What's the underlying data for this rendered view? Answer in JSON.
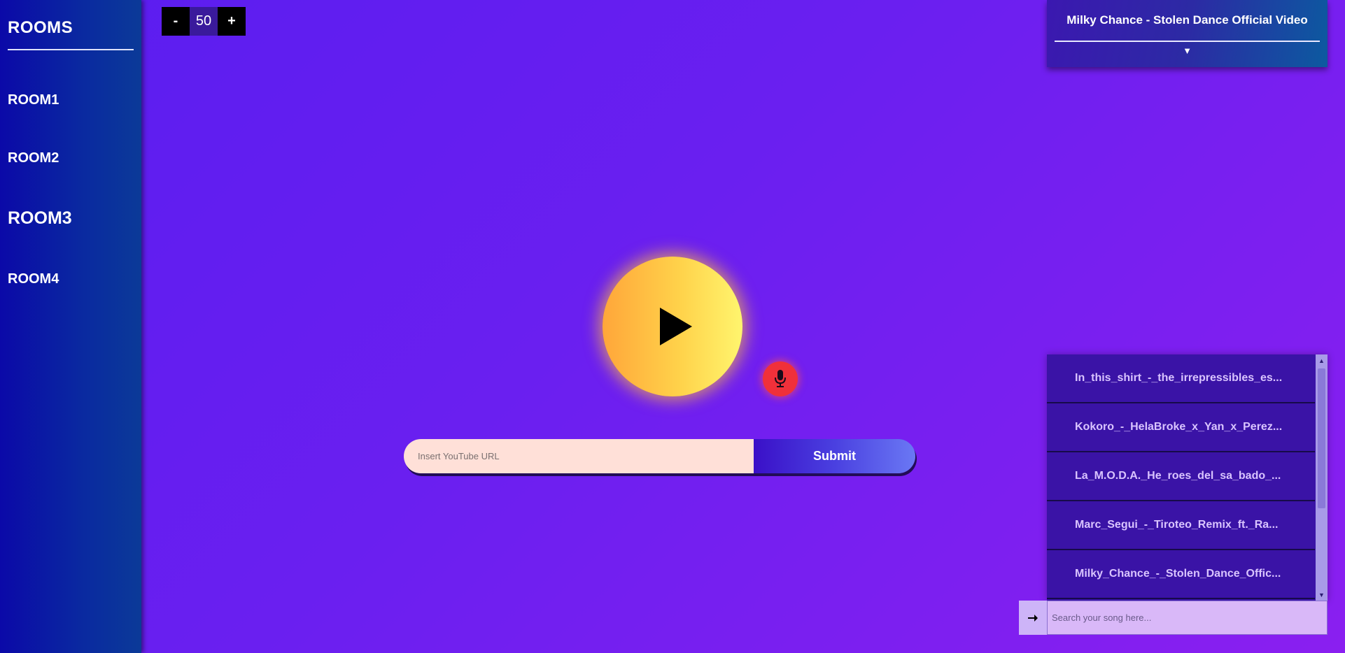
{
  "sidebar": {
    "title": "ROOMS",
    "rooms": [
      {
        "label": "ROOM1"
      },
      {
        "label": "ROOM2"
      },
      {
        "label": "ROOM3",
        "active": true
      },
      {
        "label": "ROOM4"
      }
    ]
  },
  "volume": {
    "minus_label": "-",
    "value": "50",
    "plus_label": "+"
  },
  "now_playing": {
    "title": "Milky Chance - Stolen Dance Official Video",
    "toggle_icon": "▼"
  },
  "player": {
    "play_icon": "play-icon",
    "mic_icon": "microphone-icon"
  },
  "url_form": {
    "placeholder": "Insert YouTube URL",
    "submit_label": "Submit"
  },
  "songs": [
    {
      "title": "In_this_shirt_-_the_irrepressibles_es..."
    },
    {
      "title": "Kokoro_-_HelaBroke_x_Yan_x_Perez..."
    },
    {
      "title": "La_M.O.D.A._He_roes_del_sa_bado_..."
    },
    {
      "title": "Marc_Segui_-_Tiroteo_Remix_ft._Ra..."
    },
    {
      "title": "Milky_Chance_-_Stolen_Dance_Offic..."
    }
  ],
  "search": {
    "placeholder": "Search your song here...",
    "go_icon": "arrow-right-icon"
  },
  "colors": {
    "background": "#6a1ff0",
    "sidebar": "#0b2aa0",
    "play_button": "#ffd24a",
    "mic_button": "#f0303a",
    "song_item": "#3a13a6"
  }
}
